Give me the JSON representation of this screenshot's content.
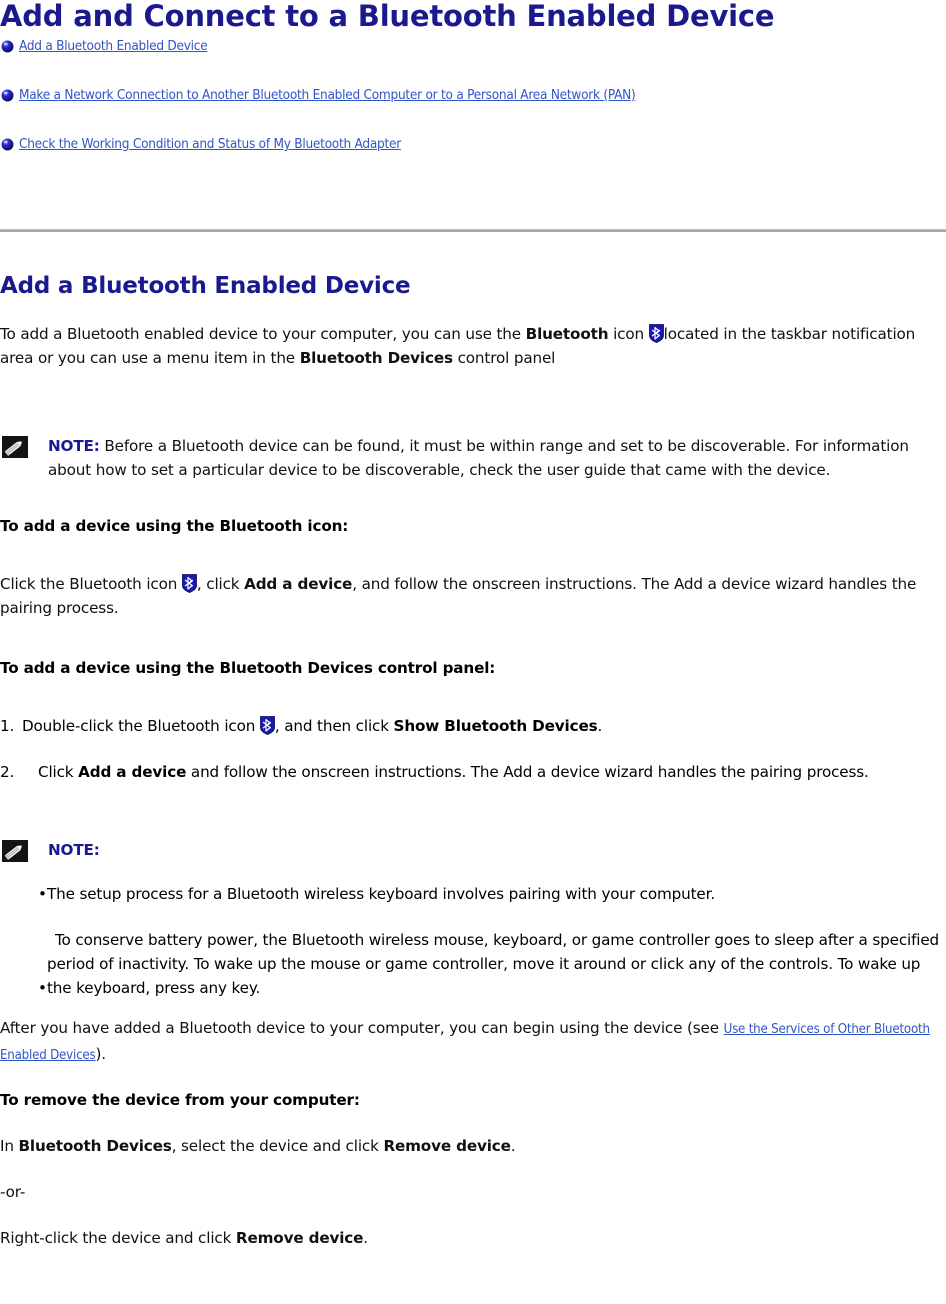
{
  "document": {
    "title": "Add and Connect to a Bluetooth Enabled Device"
  },
  "toc": {
    "items": [
      {
        "label": "Add a Bluetooth Enabled Device",
        "icon": "blue-ball-bullet-icon"
      },
      {
        "label": "Make a Network Connection to Another Bluetooth Enabled Computer or to a Personal Area Network (PAN)",
        "icon": "blue-ball-bullet-icon"
      },
      {
        "label": "Check the Working Condition and Status of My Bluetooth Adapter",
        "icon": "blue-ball-bullet-icon"
      }
    ]
  },
  "section": {
    "heading": "Add a Bluetooth Enabled Device",
    "intro": {
      "part1": "To add a Bluetooth enabled device to your computer, you can use the ",
      "bold1": "Bluetooth",
      "part2": " icon ",
      "part3": "located in the taskbar notification area or you can use a menu item in the ",
      "bold2": "Bluetooth Devices",
      "part4": " control panel"
    },
    "note1": {
      "label": "NOTE:",
      "text": " Before a Bluetooth device can be found, it must be within range and set to be discoverable. For information about how to set a particular device to be discoverable, check the user guide that came with the device."
    },
    "subhead1": "To add a device using the Bluetooth icon:",
    "para_icon_click": {
      "part1": "Click the Bluetooth icon ",
      "part2": ", click ",
      "bold1": "Add a device",
      "part3": ", and follow the onscreen instructions. The Add a device wizard handles the pairing process."
    },
    "subhead2": "To add a device using the Bluetooth Devices control panel:",
    "steps": [
      {
        "number": "1.",
        "part1": "Double-click the Bluetooth icon ",
        "part2": ", and then click ",
        "bold1": "Show Bluetooth Devices",
        "part3": "."
      },
      {
        "number": "2.",
        "part1": "Click ",
        "bold1": "Add a device",
        "part2": " and follow the onscreen instructions. The Add a device wizard handles the pairing process."
      }
    ],
    "note2": {
      "label": "NOTE:",
      "bullets": [
        {
          "marker": "•",
          "text": "The setup process for a Bluetooth wireless keyboard involves pairing with your computer."
        },
        {
          "marker": "•",
          "text": "To conserve battery power, the Bluetooth wireless mouse, keyboard, or game controller goes to sleep after a specified period of inactivity. To wake up the mouse or game controller, move it around or click any of the controls. To wake up the keyboard, press any key."
        }
      ]
    },
    "after_para": {
      "part1": "After you have added a Bluetooth device to your computer, you can begin using the device (see ",
      "link": "Use the Services of Other Bluetooth Enabled Devices",
      "part2": ")."
    },
    "subhead3": "To remove the device from your computer:",
    "remove_para": {
      "part1": "In ",
      "bold1": "Bluetooth Devices",
      "part2": ", select the device and click ",
      "bold2": "Remove device",
      "part3": "."
    },
    "or_text": "-or-",
    "rightclick_para": {
      "part1": "Right-click the device and click ",
      "bold1": "Remove device",
      "part2": "."
    }
  },
  "colors": {
    "heading_blue": "#1a1a8e",
    "link_blue": "#2f55c8",
    "bluetooth_icon_blue": "#1919b3",
    "divider_gray": "#a6a6a6",
    "body_text": "#111111"
  },
  "icons": {
    "bullet": "blue-ball-bullet-icon",
    "bluetooth": "bluetooth-icon",
    "note": "pencil-note-icon"
  }
}
